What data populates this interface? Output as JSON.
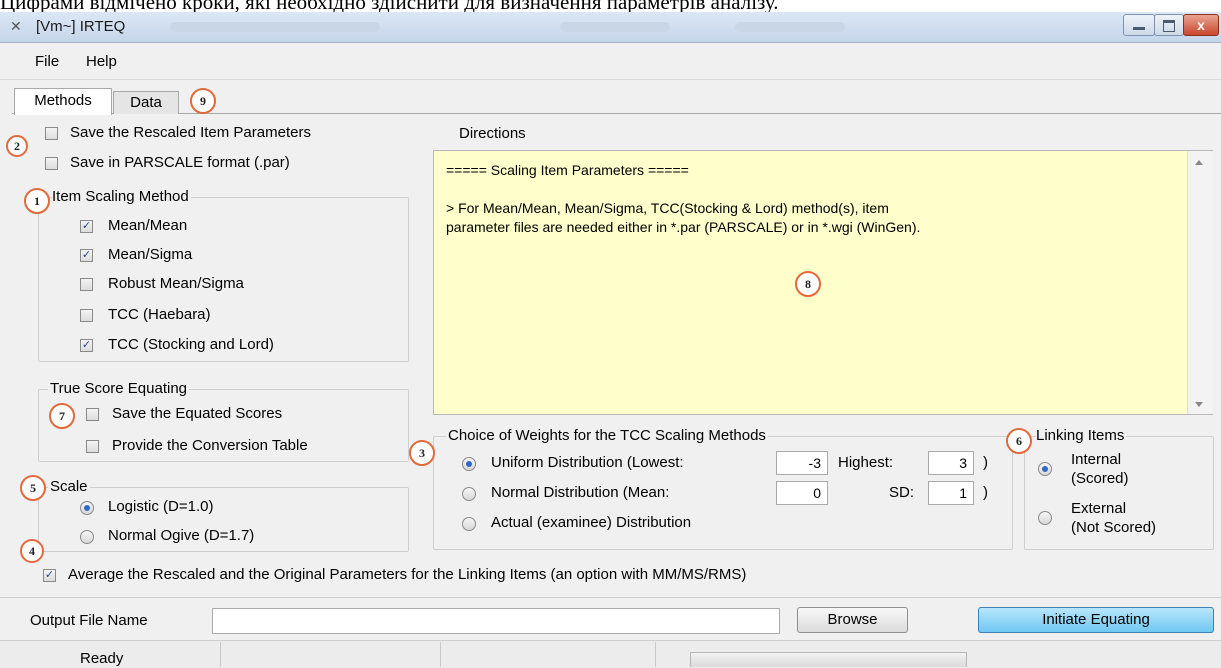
{
  "caption": "Цифрами відмічено кроки, які необхідно здійснити для визначення параметрів аналізу.",
  "window": {
    "title": "[Vm~] IRTEQ",
    "close_glyph": "x"
  },
  "menu": [
    "File",
    "Help"
  ],
  "tabs": [
    "Methods",
    "Data"
  ],
  "badges": {
    "b1": "1",
    "b2": "2",
    "b3": "3",
    "b4": "4",
    "b5": "5",
    "b6": "6",
    "b7": "7",
    "b8": "8",
    "b9": "9"
  },
  "save_options": [
    {
      "label": "Save the Rescaled Item Parameters",
      "checked": false
    },
    {
      "label": "Save in PARSCALE format (.par)",
      "checked": false
    }
  ],
  "item_scaling": {
    "title": "Item Scaling Method",
    "options": [
      {
        "label": "Mean/Mean",
        "checked": true
      },
      {
        "label": "Mean/Sigma",
        "checked": true
      },
      {
        "label": "Robust Mean/Sigma",
        "checked": false
      },
      {
        "label": "TCC (Haebara)",
        "checked": false
      },
      {
        "label": "TCC (Stocking and Lord)",
        "checked": true
      }
    ]
  },
  "true_score": {
    "title": "True Score Equating",
    "options": [
      {
        "label": "Save the Equated Scores",
        "checked": false
      },
      {
        "label": "Provide the Conversion Table",
        "checked": false
      }
    ]
  },
  "scale": {
    "title": "Scale",
    "options": [
      {
        "label": "Logistic (D=1.0)",
        "selected": true
      },
      {
        "label": "Normal Ogive (D=1.7)",
        "selected": false
      }
    ]
  },
  "directions": {
    "title": "Directions",
    "text": "===== Scaling Item Parameters =====\n\n> For Mean/Mean, Mean/Sigma, TCC(Stocking & Lord) method(s), item\nparameter files are needed either in *.par (PARSCALE) or in *.wgi (WinGen)."
  },
  "weights": {
    "title": "Choice of Weights for the TCC Scaling Methods",
    "uniform": {
      "label": "Uniform Distribution (Lowest:",
      "lowest": "-3",
      "highest_label": "Highest:",
      "highest": "3",
      "close": ")",
      "selected": true
    },
    "normal": {
      "label": "Normal Distribution  (Mean:",
      "mean": "0",
      "sd_label": "SD:",
      "sd": "1",
      "close": ")",
      "selected": false
    },
    "actual": {
      "label": "Actual (examinee) Distribution",
      "selected": false
    }
  },
  "linking": {
    "title": "Linking Items",
    "options": [
      {
        "line1": "Internal",
        "line2": "(Scored)",
        "selected": true
      },
      {
        "line1": "External",
        "line2": "(Not Scored)",
        "selected": false
      }
    ]
  },
  "average_option": {
    "label": "Average the Rescaled and the Original Parameters for the Linking Items (an option with MM/MS/RMS)",
    "checked": true
  },
  "output": {
    "label": "Output File Name",
    "value": "",
    "browse": "Browse",
    "initiate": "Initiate Equating"
  },
  "status": {
    "text": "Ready"
  },
  "icons": [
    "app-icon",
    "minimize-icon",
    "maximize-icon",
    "close-icon",
    "checkbox-icon",
    "radio-icon",
    "scroll-up-icon",
    "scroll-down-icon"
  ]
}
